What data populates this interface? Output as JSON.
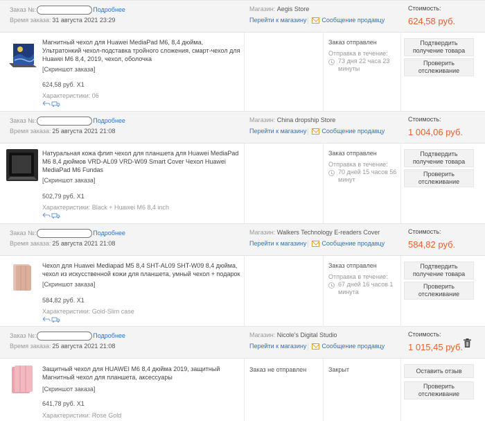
{
  "labels": {
    "order_no": "Заказ №:",
    "details": "Подробнее",
    "order_time": "Время заказа:",
    "shop": "Магазин:",
    "go_to_shop": "Перейти к магазину",
    "message_seller": "Сообщение продавцу",
    "cost": "Стоимость:",
    "snapshot": "[Скриншот заказа]",
    "characteristics": "Характеристики:",
    "confirm_receipt": "Подтвердить получение товара",
    "check_tracking": "Проверить отслеживание",
    "leave_review": "Оставить отзыв"
  },
  "orders": [
    {
      "date": "31 августа 2021 23:29",
      "shop_name": "Aegis Store",
      "cost": "624,58 руб.",
      "title": "Магнитный чехол для Huawei MediaPad M6, 8,4 дюйма, Ультратонкий чехол-подставка тройного сложения, смарт-чехол для Huawei M6 8,4, 2019, чехол, оболочка",
      "price": "624,58 руб. X1",
      "characteristics": "06",
      "status": "Заказ отправлен",
      "delivery_label": "Отправка в течение:",
      "delivery_time": "73 дня 22 часа 23 минуты"
    },
    {
      "date": "25 августа 2021 21:08",
      "shop_name": "China dropship Store",
      "cost": "1 004,06 руб.",
      "title": "Натуральная кожа флип чехол для планшета для Huawei MediaPad M6 8,4 дюймов VRD-AL09 VRD-W09 Smart Cover Чехол Huawei MediaPad M6 Fundas",
      "price": "502,79 руб. X1",
      "characteristics": "Black + Huawei M6 8,4 inch",
      "status": "Заказ отправлен",
      "delivery_label": "Отправка в течение:",
      "delivery_time": "70 дней 15 часов 56 минут"
    },
    {
      "date": "25 августа 2021 21:08",
      "shop_name": "Walkers Technology E-readers Cover",
      "cost": "584,82 руб.",
      "title": "Чехол для Huawei Mediapad M5 8,4 SHT-AL09 SHT-W09 8,4 дюйма, чехол из искусственной кожи для планшета, умный чехол + подарок",
      "price": "584,82 руб. X1",
      "characteristics": "Gold-Slim case",
      "status": "Заказ отправлен",
      "delivery_label": "Отправка в течение:",
      "delivery_time": "67 дней 16 часов 1 минута"
    },
    {
      "date": "25 августа 2021 21:08",
      "shop_name": "Nicole's Digital Studio",
      "cost": "1 015,45 руб.",
      "title": "Защитный чехол для HUAWEI M6 8,4 дюйма 2019, защитный Магнитный чехол для планшета, аксессуары",
      "price": "641,78 руб. X1",
      "characteristics": "Rose Gold",
      "status": "Заказ не отправлен",
      "closed": "Закрыт"
    }
  ],
  "icons": [
    "mail-icon",
    "clock-icon",
    "trash-icon",
    "reply-icon",
    "truck-icon"
  ],
  "colors": {
    "accent_price": "#e8602c",
    "link": "#2a73c7",
    "mail_icon": "#e0a020"
  }
}
